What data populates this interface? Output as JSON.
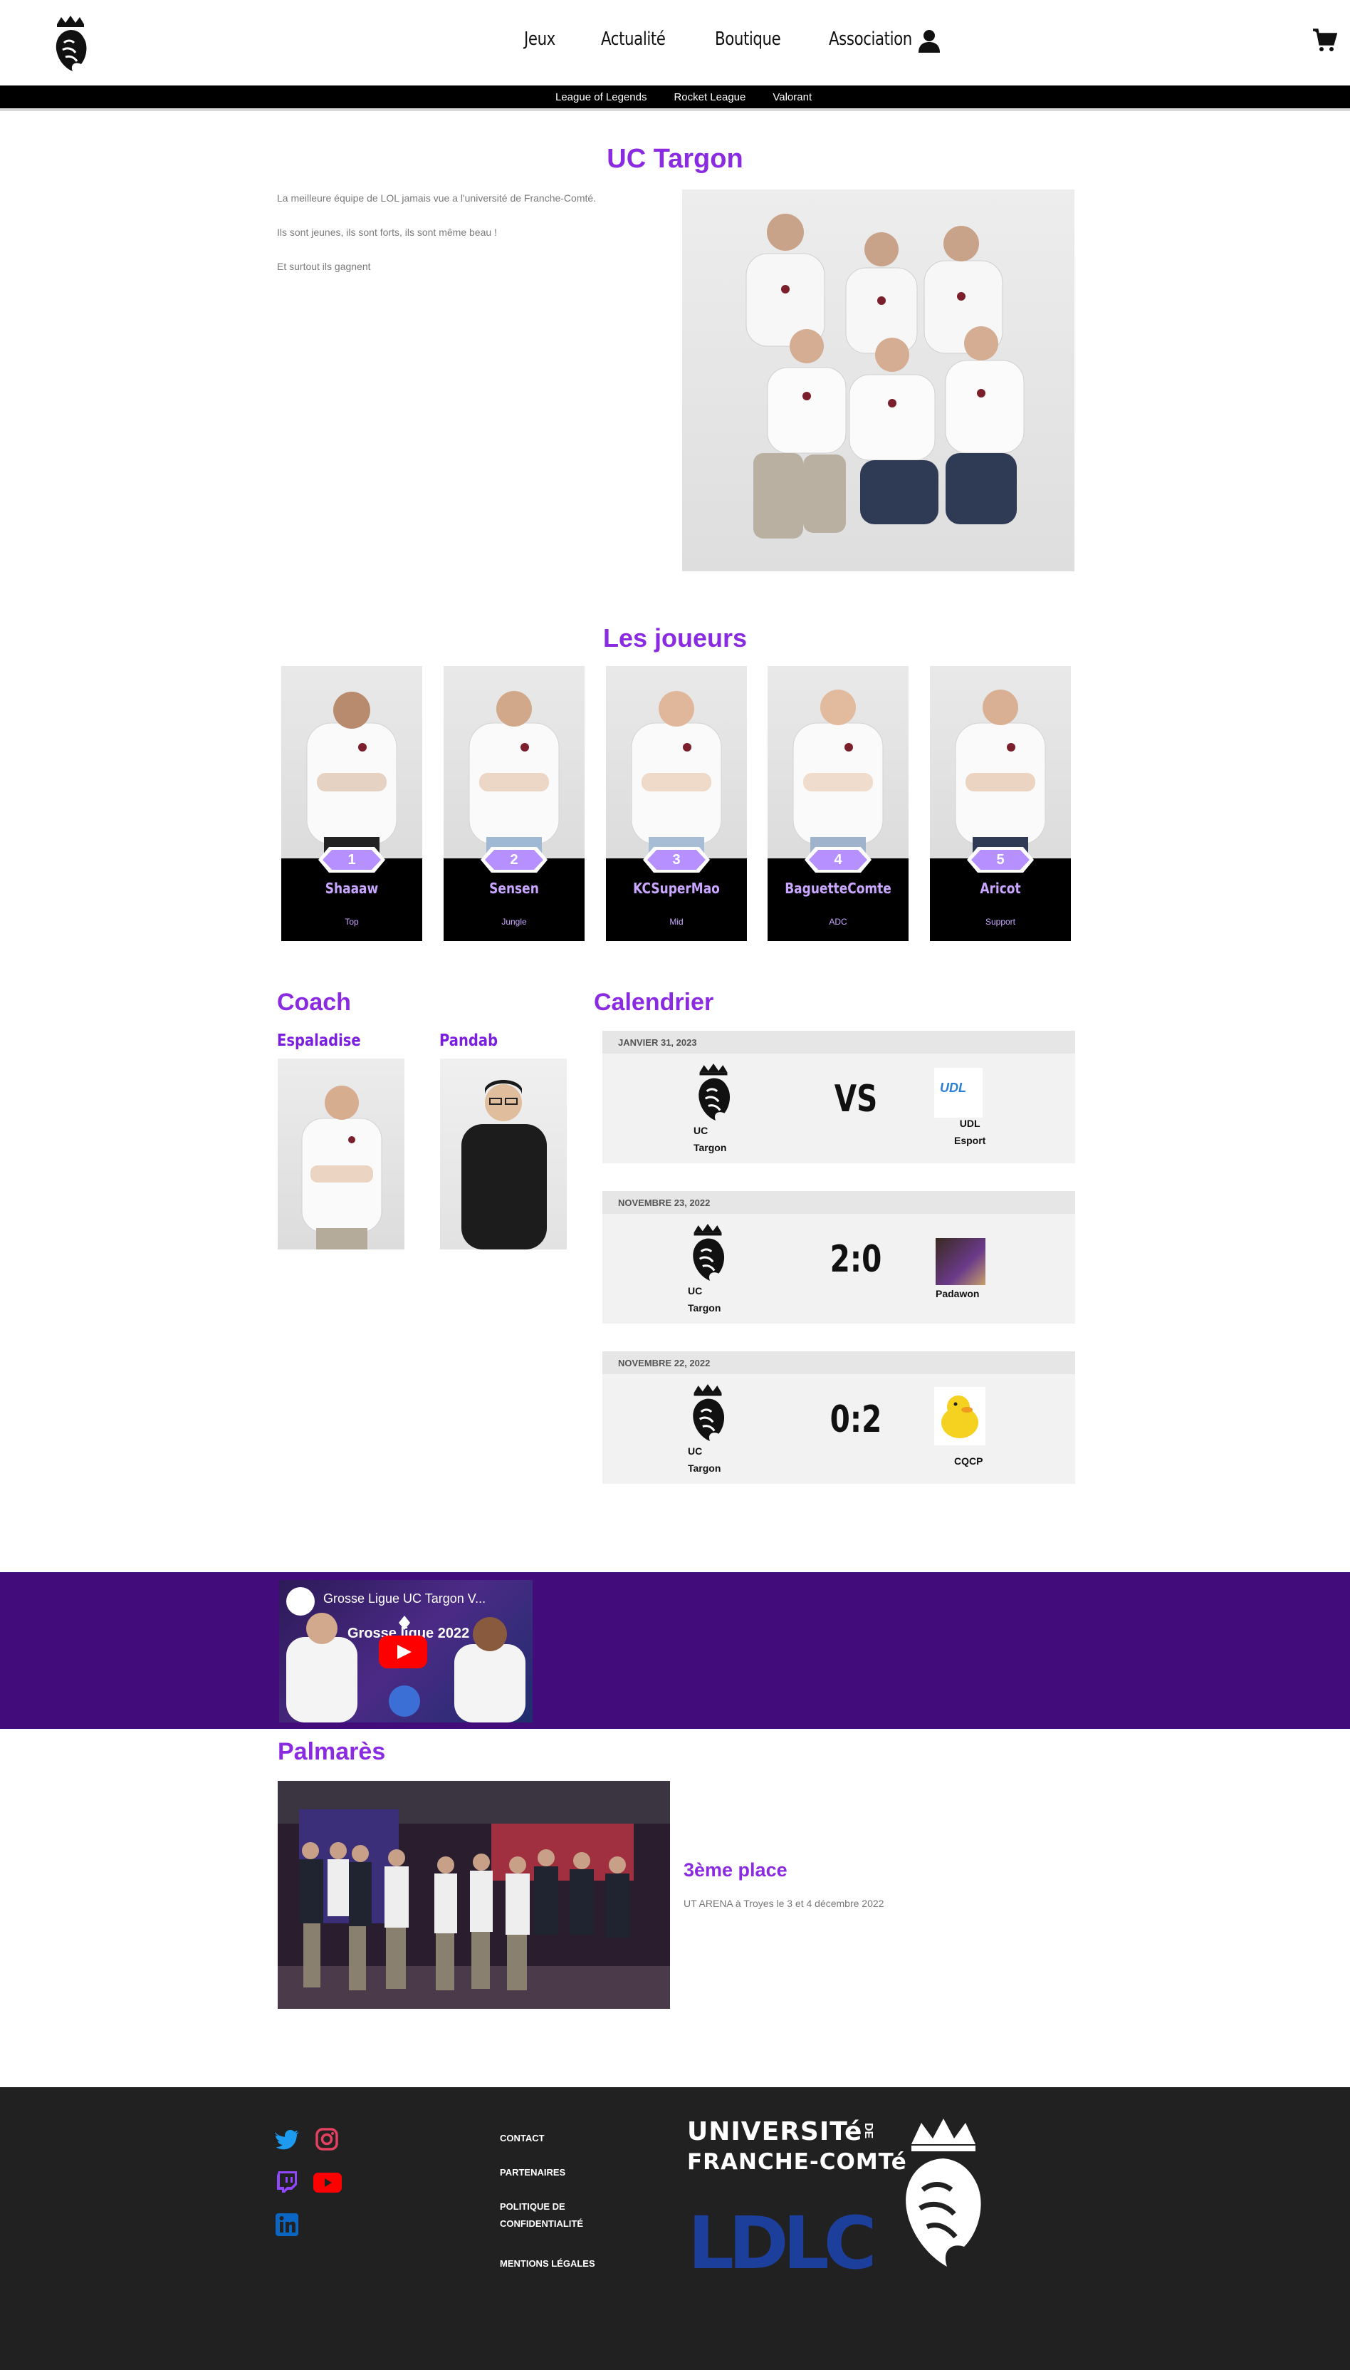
{
  "header": {
    "nav": [
      "Jeux",
      "Actualité",
      "Boutique",
      "Association"
    ],
    "subnav": [
      "League of Legends",
      "Rocket League",
      "Valorant"
    ]
  },
  "hero": {
    "title": "UC Targon",
    "paragraphs": [
      "La meilleure équipe de LOL jamais vue a l'université de Franche-Comté.",
      "Ils sont jeunes, ils sont forts, ils sont même beau !",
      "Et surtout ils gagnent"
    ]
  },
  "players": {
    "title": "Les joueurs",
    "list": [
      {
        "num": "1",
        "name": "Shaaaw",
        "role": "Top"
      },
      {
        "num": "2",
        "name": "Sensen",
        "role": "Jungle"
      },
      {
        "num": "3",
        "name": "KCSuperMao",
        "role": "Mid"
      },
      {
        "num": "4",
        "name": "BaguetteComte",
        "role": "ADC"
      },
      {
        "num": "5",
        "name": "Aricot",
        "role": "Support"
      }
    ]
  },
  "coach": {
    "title": "Coach",
    "list": [
      {
        "name": "Espaladise"
      },
      {
        "name": "Pandab"
      }
    ]
  },
  "calendar": {
    "title": "Calendrier",
    "matches": [
      {
        "date": "JANVIER 31, 2023",
        "team_line1": "UC",
        "team_line2": "Targon",
        "score": "VS",
        "opp_line1": "UDL",
        "opp_line2": "Esport",
        "opp_logo_text": "UDL"
      },
      {
        "date": "NOVEMBRE 23, 2022",
        "team_line1": "UC",
        "team_line2": "Targon",
        "score": "2:0",
        "opp_line1": "",
        "opp_line2": "Padawon",
        "opp_logo_text": ""
      },
      {
        "date": "NOVEMBRE 22, 2022",
        "team_line1": "UC",
        "team_line2": "Targon",
        "score": "0:2",
        "opp_line1": "",
        "opp_line2": "CQCP",
        "opp_logo_text": ""
      }
    ]
  },
  "video": {
    "title": "Grosse Ligue UC Targon V...",
    "center_text": "Grosse ligue 2022"
  },
  "palmares": {
    "title": "Palmarès",
    "place": "3ème place",
    "description": "UT ARENA à Troyes le 3 et 4 décembre 2022"
  },
  "footer": {
    "links": [
      "CONTACT",
      "PARTENAIRES",
      "POLITIQUE DE",
      "CONFIDENTIALITÉ",
      "MENTIONS LÉGALES"
    ],
    "university_line1": "UNIVERSITé",
    "university_line2": "FRANCHE-COMTé",
    "university_de": "DE",
    "sponsor": "LDLC"
  },
  "colors": {
    "accent": "#8a2be2",
    "band": "#420c7a",
    "footer_bg": "#212121"
  }
}
